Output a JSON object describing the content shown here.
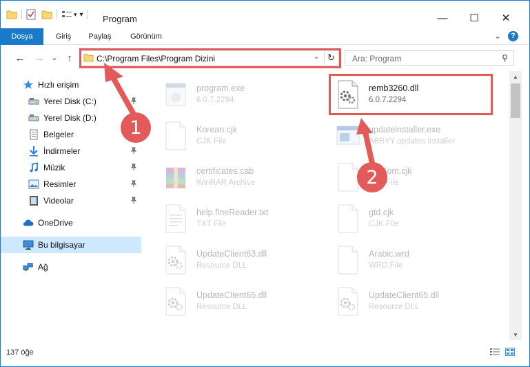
{
  "window": {
    "title": "Program",
    "minimize": "—",
    "maximize": "☐",
    "close": "✕"
  },
  "ribbon": {
    "tabs": [
      "Dosya",
      "Giriş",
      "Paylaş",
      "Görünüm"
    ],
    "expand": "⌄",
    "help": "?"
  },
  "nav": {
    "back": "←",
    "forward": "→",
    "recent": "⌄",
    "up": "↑",
    "address": "C:\\Program Files\\Program Dizini",
    "address_dropdown": "⌄",
    "refresh": "↻",
    "search_placeholder": "Ara: Program",
    "search_glyph": "⚲"
  },
  "sidebar": {
    "items": [
      {
        "label": "Hızlı erişim",
        "icon": "star-icon",
        "pinned": false
      },
      {
        "label": "Yerel Disk (C:)",
        "icon": "drive-icon",
        "pinned": true
      },
      {
        "label": "Yerel Disk (D:)",
        "icon": "drive-icon",
        "pinned": false
      },
      {
        "label": "Belgeler",
        "icon": "documents-icon",
        "pinned": true
      },
      {
        "label": "İndirmeler",
        "icon": "download-icon",
        "pinned": true
      },
      {
        "label": "Müzik",
        "icon": "music-icon",
        "pinned": true
      },
      {
        "label": "Resimler",
        "icon": "pictures-icon",
        "pinned": true
      },
      {
        "label": "Videolar",
        "icon": "videos-icon",
        "pinned": true
      },
      {
        "label": "OneDrive",
        "icon": "cloud-icon",
        "pinned": false
      },
      {
        "label": "Bu bilgisayar",
        "icon": "computer-icon",
        "pinned": false
      },
      {
        "label": "Ağ",
        "icon": "network-icon",
        "pinned": false
      }
    ],
    "pin_glyph": "📌"
  },
  "files": [
    {
      "name": "program.exe",
      "sub": "6.0.7.2294",
      "icon": "exe-icon",
      "highlighted": false
    },
    {
      "name": "remb3260.dll",
      "sub": "6.0.7.2294",
      "icon": "dll-gear-icon",
      "highlighted": true
    },
    {
      "name": "Korean.cjk",
      "sub": "CJK File",
      "icon": "blank-file-icon",
      "highlighted": false
    },
    {
      "name": "updateinstaller.exe",
      "sub": "ABBYY updates installer",
      "icon": "installer-icon",
      "highlighted": false
    },
    {
      "name": "certificates.cab",
      "sub": "WinRAR Archive",
      "icon": "winrar-icon",
      "highlighted": false
    },
    {
      "name": "PRCom.cjk",
      "sub": "CJK File",
      "icon": "blank-file-icon",
      "highlighted": false
    },
    {
      "name": "help.fineReader.txt",
      "sub": "TXT File",
      "icon": "text-file-icon",
      "highlighted": false
    },
    {
      "name": "gtd.cjk",
      "sub": "CJK File",
      "icon": "blank-file-icon",
      "highlighted": false
    },
    {
      "name": "UpdateClient63.dll",
      "sub": "Resource DLL",
      "icon": "dll-gear-icon",
      "highlighted": false
    },
    {
      "name": "Arabic.wrd",
      "sub": "WRD File",
      "icon": "blank-file-icon",
      "highlighted": false
    },
    {
      "name": "UpdateClient65.dll",
      "sub": "Resource DLL",
      "icon": "dll-gear-icon",
      "highlighted": false
    },
    {
      "name": "UpdateClient65.dll",
      "sub": "Resource DLL",
      "icon": "dll-gear-icon",
      "highlighted": false
    }
  ],
  "status": {
    "count": "137 öğe"
  },
  "annotations": {
    "step1": "1",
    "step2": "2",
    "color": "#e25a5a"
  },
  "colors": {
    "accent": "#1979ca",
    "selection": "#cde8ff"
  }
}
